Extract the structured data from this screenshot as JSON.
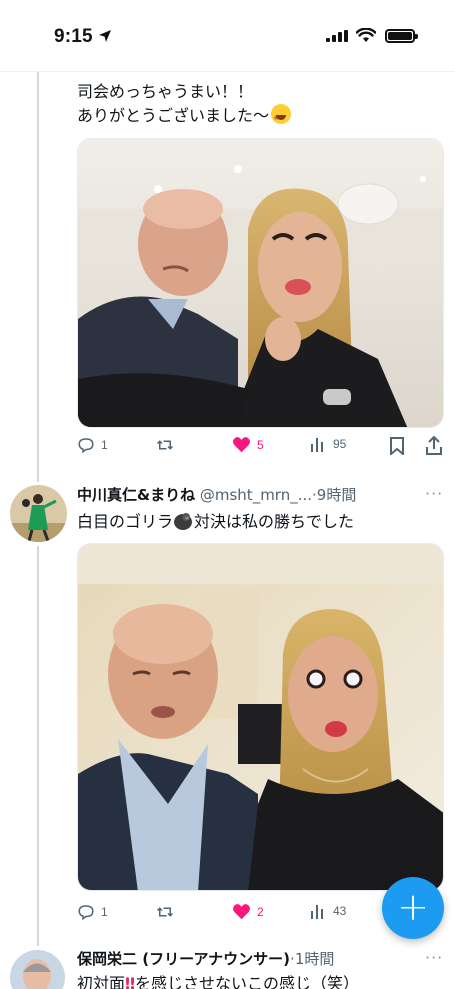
{
  "status_bar": {
    "time": "9:15"
  },
  "tweets": [
    {
      "text_lines": [
        "司会めっちゃうまい！！",
        "ありがとうございました〜"
      ],
      "emoji": "star-struck-emoji",
      "actions": {
        "replies": "1",
        "retweets": "",
        "likes": "5",
        "views": "95"
      }
    },
    {
      "name": "中川真仁&まりね",
      "handle": "@msht_mrn_...",
      "time": "·9時間",
      "text_before": "白目のゴリラ",
      "emoji": "gorilla-emoji",
      "text_after": "対決は私の勝ちでした",
      "actions": {
        "replies": "1",
        "retweets": "",
        "likes": "2",
        "views": "43"
      }
    },
    {
      "name": "保岡栄二 (フリーアナウンサー)",
      "time": "·1時間",
      "text_before": "初対面",
      "text_after": "を感じさせないこの感じ（笑）",
      "emoji": "double-exclamation-emoji"
    }
  ],
  "fab": {
    "label": "+"
  },
  "colors": {
    "accent": "#1d9bf0",
    "like": "#f91880",
    "muted": "#536471"
  }
}
